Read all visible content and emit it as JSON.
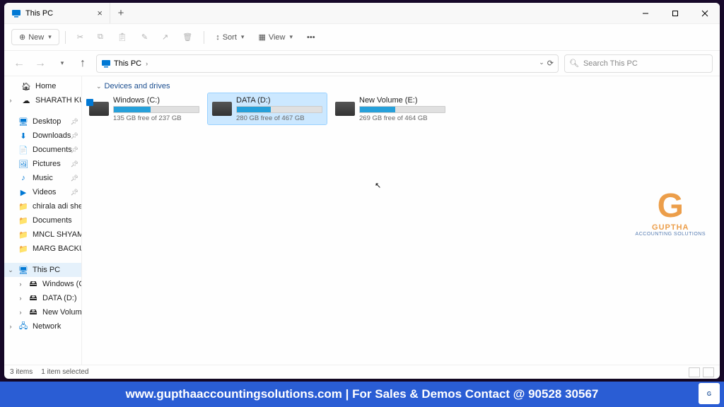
{
  "titlebar": {
    "tab_title": "This PC"
  },
  "toolbar": {
    "new_label": "New",
    "sort_label": "Sort",
    "view_label": "View"
  },
  "address": {
    "crumb": "This PC",
    "search_placeholder": "Search This PC"
  },
  "sidebar": {
    "home": "Home",
    "user": "SHARATH KUMAR",
    "desktop": "Desktop",
    "downloads": "Downloads",
    "documents": "Documents",
    "pictures": "Pictures",
    "music": "Music",
    "videos": "Videos",
    "f1": "chirala adi sheshu s",
    "f2": "Documents",
    "f3": "MNCL SHYAM SUN",
    "f4": "MARG BACKUP",
    "this_pc": "This PC",
    "c": "Windows (C:)",
    "d": "DATA (D:)",
    "e": "New Volume (E:)",
    "network": "Network"
  },
  "group_header": "Devices and drives",
  "drives": {
    "c": {
      "name": "Windows (C:)",
      "free": "135 GB free of 237 GB",
      "pct": 43
    },
    "d": {
      "name": "DATA (D:)",
      "free": "280 GB free of 467 GB",
      "pct": 40
    },
    "e": {
      "name": "New Volume (E:)",
      "free": "269 GB free of 464 GB",
      "pct": 42
    }
  },
  "status": {
    "count": "3 items",
    "selected": "1 item selected"
  },
  "watermark": {
    "brand": "GUPTHA",
    "sub": "ACCOUNTING SOLUTIONS"
  },
  "banner": "www.gupthaaccountingsolutions.com | For Sales & Demos Contact @ 90528 30567"
}
